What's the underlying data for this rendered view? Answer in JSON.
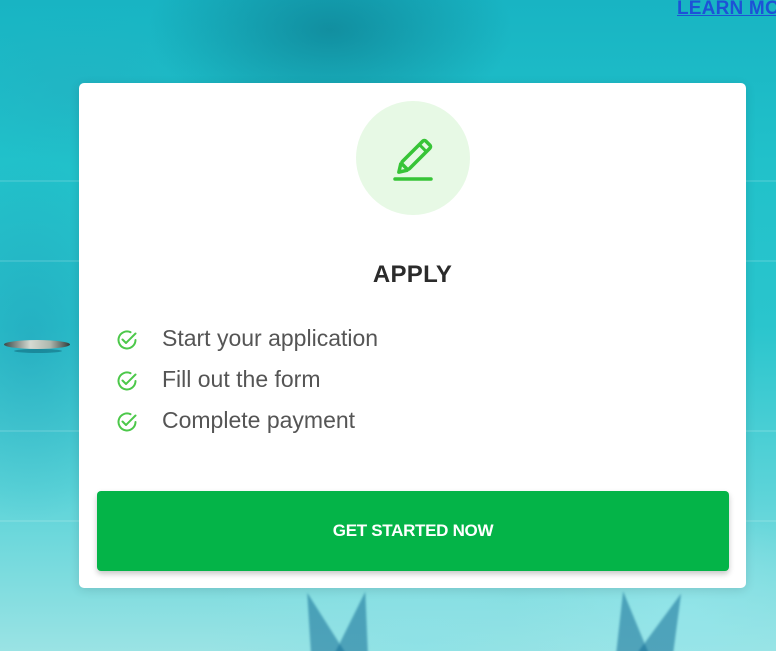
{
  "header": {
    "learn_more_link": "LEARN MORE"
  },
  "card": {
    "icon": "pencil-icon",
    "title": "APPLY",
    "steps": [
      {
        "icon": "check-circle-icon",
        "label": "Start your application"
      },
      {
        "icon": "check-circle-icon",
        "label": "Fill out the form"
      },
      {
        "icon": "check-circle-icon",
        "label": "Complete payment"
      }
    ],
    "cta_label": "GET STARTED NOW"
  },
  "colors": {
    "accent_green": "#04b448",
    "icon_bg": "#e7f9e5",
    "check_green": "#4cc84a",
    "link_blue": "#1d52d6",
    "ocean": "#21c1ca"
  }
}
